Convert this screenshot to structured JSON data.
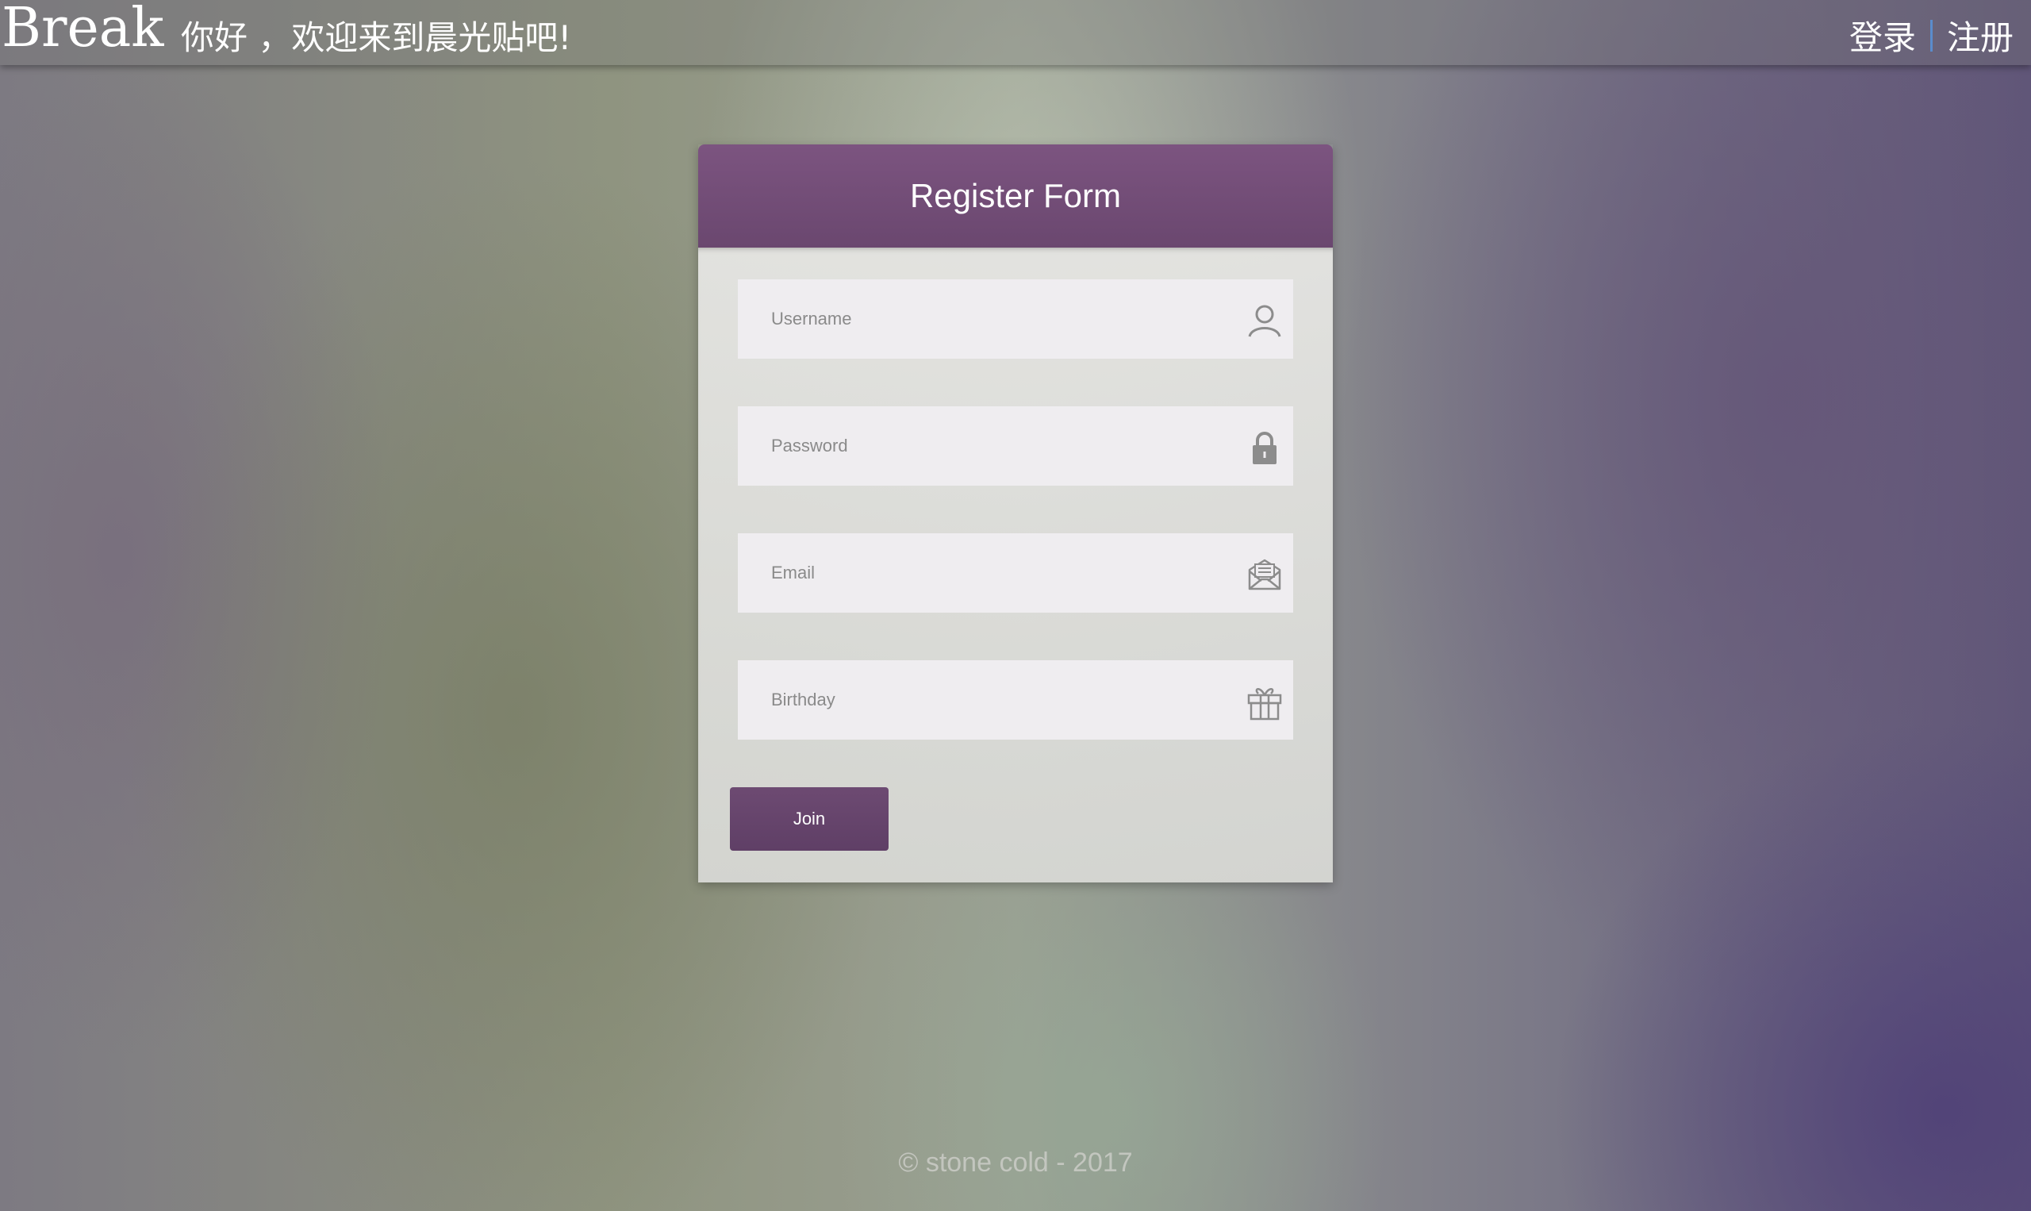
{
  "header": {
    "brand": "Break",
    "welcome": "你好 ，欢迎来到晨光贴吧!",
    "nav": {
      "login": "登录",
      "register": "注册"
    }
  },
  "form": {
    "title": "Register Form",
    "fields": [
      {
        "placeholder": "Username",
        "value": "",
        "icon": "user-icon"
      },
      {
        "placeholder": "Password",
        "value": "",
        "icon": "lock-icon"
      },
      {
        "placeholder": "Email",
        "value": "",
        "icon": "envelope-icon"
      },
      {
        "placeholder": "Birthday",
        "value": "",
        "icon": "gift-icon"
      }
    ],
    "submit_label": "Join"
  },
  "footer": {
    "text": "© stone cold - 2017"
  },
  "colors": {
    "accent": "#6a476f",
    "header_bar": "#7c5480",
    "nav_divider": "#5a8ccc",
    "icon_gray": "#8c8c8c"
  }
}
